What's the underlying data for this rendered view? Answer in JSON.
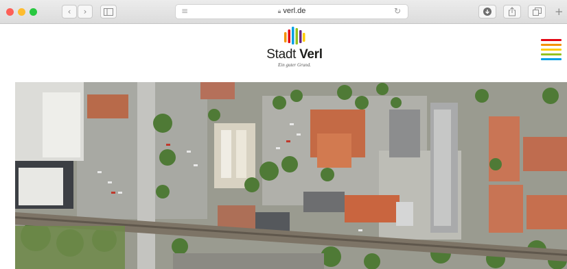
{
  "browser": {
    "url": "verl.de",
    "lock_icon": "lock-icon",
    "traffic_lights": [
      "#fd5f57",
      "#febc2e",
      "#28c840"
    ],
    "toolbar_icons": [
      "chevron-left-icon",
      "chevron-right-icon",
      "sidebar-icon",
      "reader-icon",
      "reload-icon",
      "download-icon",
      "share-icon",
      "tabs-icon",
      "plus-icon"
    ]
  },
  "site": {
    "logo_name": "Stadt",
    "logo_name_bold": "Verl",
    "tagline": "Ein guter Grund.",
    "logo_colors": [
      "#f39200",
      "#e30613",
      "#009fe3",
      "#95c11f",
      "#662483",
      "#ffcc00"
    ],
    "menu_icon": "hamburger-menu-icon",
    "menu_colors": [
      "#e30613",
      "#f39200",
      "#ffcc00",
      "#95c11f",
      "#009fe3"
    ]
  },
  "hero": {
    "image": "aerial-town-photo"
  }
}
